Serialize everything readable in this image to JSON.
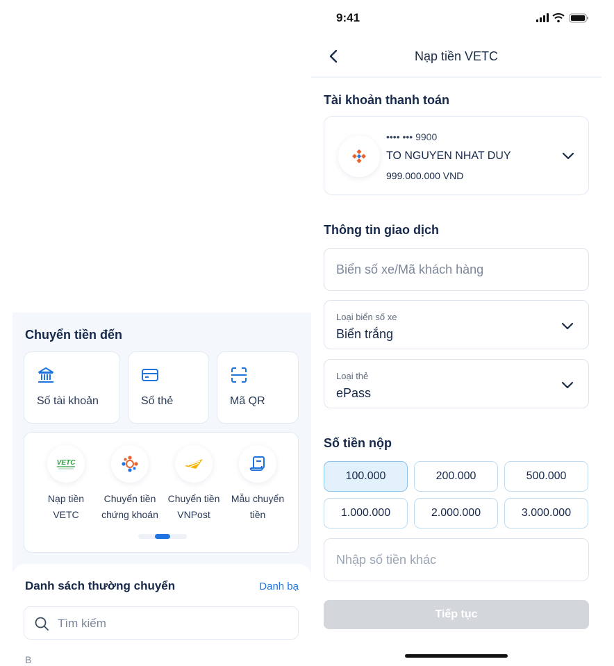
{
  "left": {
    "section_title": "Chuyển tiền đến",
    "quick_actions": [
      {
        "label": "Số tài khoản",
        "icon": "bank-icon"
      },
      {
        "label": "Số thẻ",
        "icon": "card-icon"
      },
      {
        "label": "Mã QR",
        "icon": "qr-scan-icon"
      }
    ],
    "services": [
      {
        "line1": "Nạp tiền",
        "line2": "VETC",
        "icon": "vetc-logo-icon"
      },
      {
        "line1": "Chuyển tiền",
        "line2": "chứng khoán",
        "icon": "securities-icon"
      },
      {
        "line1": "Chuyển tiền",
        "line2": "VNPost",
        "icon": "vnpost-icon"
      },
      {
        "line1": "Mẫu chuyển",
        "line2": "tiền",
        "icon": "template-icon"
      }
    ],
    "vetc_logo_text": "VETC",
    "contacts": {
      "title": "Danh sách thường chuyển",
      "link": "Danh bạ",
      "search_placeholder": "Tìm kiếm",
      "first_letter": "B"
    },
    "colors": {
      "accent": "#1f74e0",
      "background": "#f4f7fc"
    }
  },
  "right": {
    "status_time": "9:41",
    "nav_title": "Nạp tiền VETC",
    "account_section": "Tài khoản thanh toán",
    "account": {
      "number": "•••• ••• 9900",
      "holder": "TO NGUYEN NHAT DUY",
      "balance": "999.000.000 VND"
    },
    "transaction_section": "Thông tin giao dịch",
    "plate_placeholder": "Biển số xe/Mã khách hàng",
    "plate_type": {
      "label": "Loại biển số xe",
      "value": "Biển trắng"
    },
    "card_type": {
      "label": "Loại thẻ",
      "value": "ePass"
    },
    "amount_section": "Số tiền nộp",
    "amounts": [
      "100.000",
      "200.000",
      "500.000",
      "1.000.000",
      "2.000.000",
      "3.000.000"
    ],
    "selected_amount": "100.000",
    "other_amount_placeholder": "Nhập số tiền khác",
    "continue_label": "Tiếp tục",
    "colors": {
      "selected_amount_bg": "#e3f1fc",
      "button_disabled": "#d3d6db"
    }
  }
}
